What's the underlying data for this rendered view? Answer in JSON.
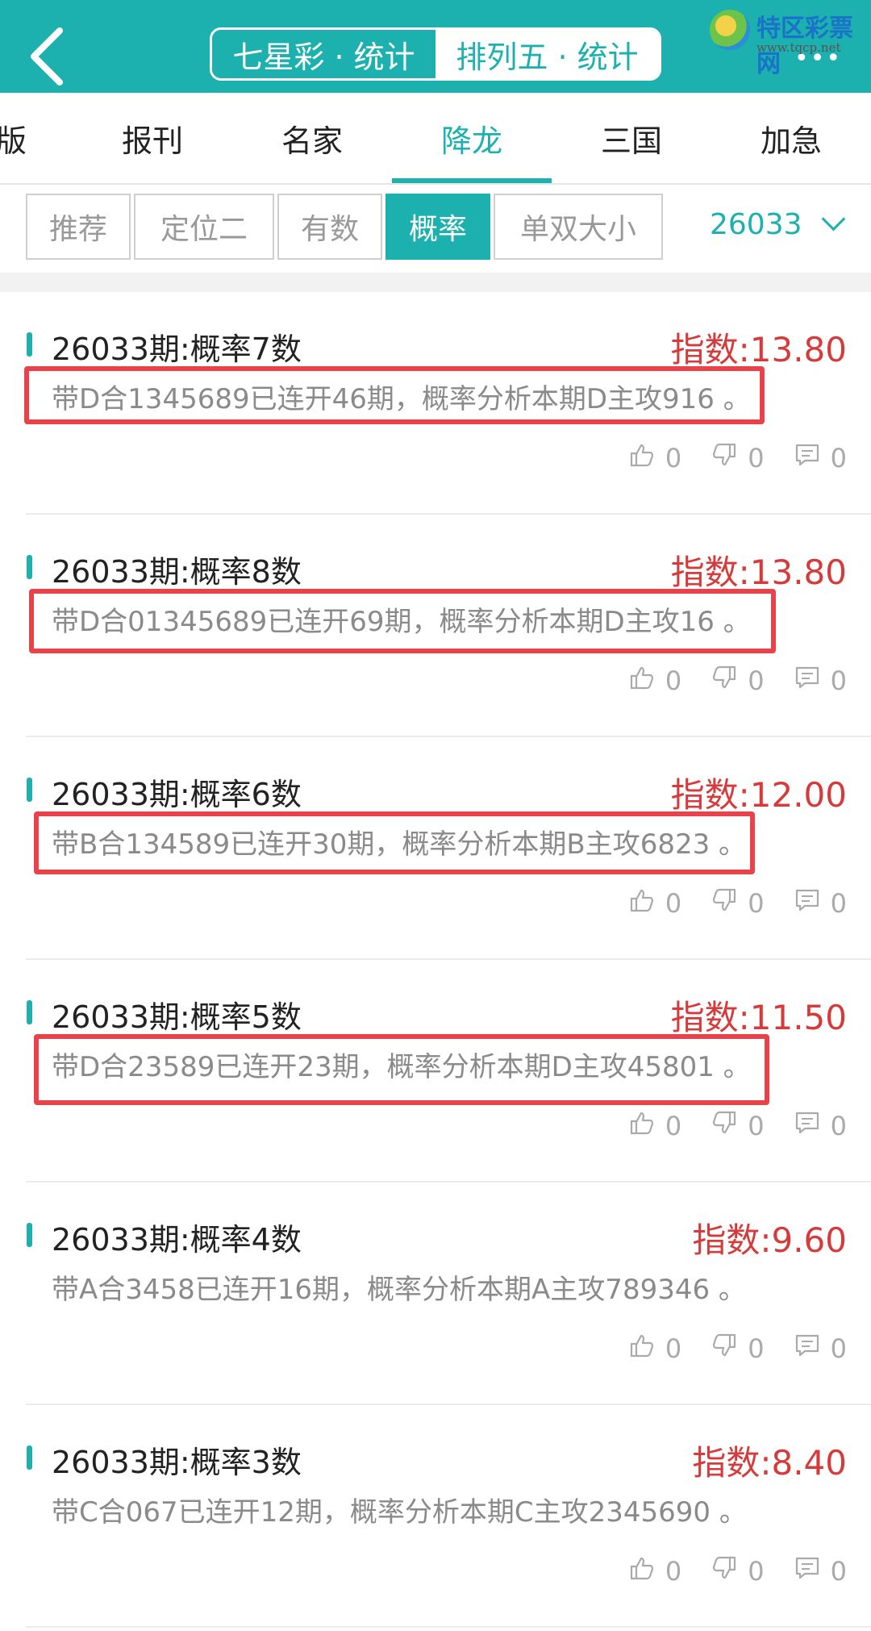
{
  "header": {
    "seg_left": "七星彩 · 统计",
    "seg_right": "排列五 · 统计",
    "more": "•••",
    "logo_name": "特区彩票网",
    "logo_url": "www.tqcp.net"
  },
  "nav_tabs": [
    "版",
    "报刊",
    "名家",
    "降龙",
    "三国",
    "加急"
  ],
  "filter_tabs": [
    "推荐",
    "定位二",
    "有数",
    "概率",
    "单双大小"
  ],
  "issue_select": "26033",
  "cards": [
    {
      "title": "26033期:概率7数",
      "score": "指数:13.80",
      "desc": "带D合1345689已连开46期，概率分析本期D主攻916 。",
      "like": "0",
      "dislike": "0",
      "comment": "0"
    },
    {
      "title": "26033期:概率8数",
      "score": "指数:13.80",
      "desc": "带D合01345689已连开69期，概率分析本期D主攻16 。",
      "like": "0",
      "dislike": "0",
      "comment": "0"
    },
    {
      "title": "26033期:概率6数",
      "score": "指数:12.00",
      "desc": "带B合134589已连开30期，概率分析本期B主攻6823 。",
      "like": "0",
      "dislike": "0",
      "comment": "0"
    },
    {
      "title": "26033期:概率5数",
      "score": "指数:11.50",
      "desc": "带D合23589已连开23期，概率分析本期D主攻45801 。",
      "like": "0",
      "dislike": "0",
      "comment": "0"
    },
    {
      "title": "26033期:概率4数",
      "score": "指数:9.60",
      "desc": "带A合3458已连开16期，概率分析本期A主攻789346 。",
      "like": "0",
      "dislike": "0",
      "comment": "0"
    },
    {
      "title": "26033期:概率3数",
      "score": "指数:8.40",
      "desc": "带C合067已连开12期，概率分析本期C主攻2345690 。",
      "like": "0",
      "dislike": "0",
      "comment": "0"
    }
  ]
}
